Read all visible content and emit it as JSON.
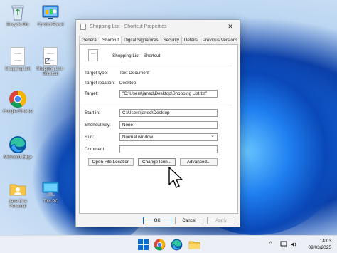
{
  "desktop": {
    "icons": [
      {
        "label": "Recycle Bin",
        "icon": "recycle-bin-icon"
      },
      {
        "label": "Control Panel",
        "icon": "control-panel-icon"
      },
      {
        "label": "Shopping List",
        "icon": "text-document-icon"
      },
      {
        "label": "Shopping List - Shortcut",
        "icon": "shortcut-document-icon"
      },
      {
        "label": "Google Chrome",
        "icon": "chrome-icon"
      },
      {
        "label": "Microsoft Edge",
        "icon": "edge-icon"
      },
      {
        "label": "Jane Doe Personal",
        "icon": "user-folder-icon"
      },
      {
        "label": "This PC",
        "icon": "this-pc-icon"
      }
    ]
  },
  "dialog": {
    "title": "Shopping List - Shortcut Properties",
    "close_glyph": "✕",
    "tabs": [
      "General",
      "Shortcut",
      "Digital Signatures",
      "Security",
      "Details",
      "Previous Versions"
    ],
    "active_tab": "Shortcut",
    "shortcut_name": "Shopping List - Shortcut",
    "target_type_label": "Target type:",
    "target_type_value": "Text Document",
    "target_location_label": "Target location:",
    "target_location_value": "Desktop",
    "target_label": "Target:",
    "target_value": "\"C:\\Users\\janed\\Desktop\\Shopping List.txt\"",
    "start_in_label": "Start in:",
    "start_in_value": "C:\\Users\\janed\\Desktop",
    "shortcut_key_label": "Shortcut key:",
    "shortcut_key_value": "None",
    "run_label": "Run:",
    "run_value": "Normal window",
    "comment_label": "Comment:",
    "comment_value": "",
    "open_file_location": "Open File Location",
    "change_icon": "Change Icon...",
    "advanced": "Advanced...",
    "ok": "OK",
    "cancel": "Cancel",
    "apply": "Apply"
  },
  "taskbar": {
    "apps": [
      "windows-start-icon",
      "chrome-icon",
      "edge-icon",
      "file-explorer-icon"
    ],
    "tray": {
      "chevron": "^",
      "time": "14:03",
      "date": "09/03/2025"
    }
  },
  "colors": {
    "accent": "#0067c0",
    "taskbar": "#ecf0f6",
    "dialog_bg": "#f3f3f3"
  }
}
